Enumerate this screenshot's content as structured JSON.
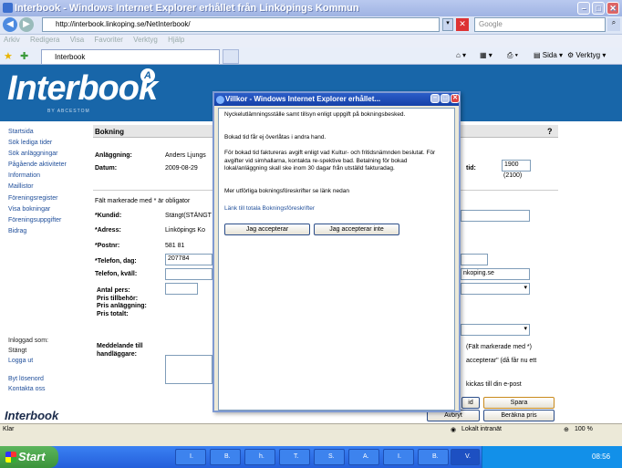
{
  "window": {
    "title": "Interbook - Windows Internet Explorer erhållet från Linköpings Kommun"
  },
  "address": {
    "url": "http://interbook.linkoping.se/NetInterbook/",
    "search_placeholder": "Google"
  },
  "menu": [
    "Arkiv",
    "Redigera",
    "Visa",
    "Favoriter",
    "Verktyg",
    "Hjälp"
  ],
  "tab": {
    "label": "Interbook"
  },
  "toolbar": {
    "sida": "Sida",
    "verktyg": "Verktyg"
  },
  "logo": {
    "text": "Interbook",
    "subtitle": "BY ABCESTOM",
    "badge": "A"
  },
  "sidebar": {
    "items": [
      "Startsida",
      "Sök lediga tider",
      "Sök anläggningar",
      "Pågående aktiviteter",
      "Information",
      "Maillistor",
      "Föreningsregister",
      "Visa bokningar",
      "Föreningsuppgifter",
      "Bidrag"
    ],
    "logged_label": "Inloggad som:",
    "user": "Stängt",
    "logout": "Logga ut",
    "change_pw": "Byt lösenord",
    "contact": "Kontakta oss",
    "footer_logo": "Interbook"
  },
  "booking": {
    "title": "Bokning",
    "help": "?",
    "facility_label": "Anläggning:",
    "facility_value": "Anders Ljungs",
    "date_label": "Datum:",
    "date_value": "2009-08-29",
    "time_label": "tid:",
    "time_value": "1900",
    "time_sub": "(2100)",
    "required_note": "Fält markerade med * är obligator",
    "kund_label": "*Kundid:",
    "kund_value": "Stängt(STÄNGT",
    "adress_label": "*Adress:",
    "adress_value": "Linköpings Ko",
    "postnr_label": "*Postnr:",
    "postnr_value": "581 81",
    "tel_dag_label": "*Telefon, dag:",
    "tel_dag_value": "207784",
    "tel_kvall_label": "Telefon, kväll:",
    "antal_label": "Antal pers:",
    "pris_tillbehor": "Pris tillbehör:",
    "pris_anl": "Pris anläggning:",
    "pris_tot": "Pris totalt:",
    "meddelande_label": "Meddelande till handläggare:",
    "email_value": "nkoping.se",
    "right_note1": "(Fält markerade med *)",
    "right_note2": "accepterar\" (då får nu ett",
    "right_note3": "kickas till din e-post",
    "btn_left": "id",
    "btn_save": "Spara",
    "btn_avbryt": "Avbryt",
    "btn_berakna": "Beräkna pris"
  },
  "dialog": {
    "title": "Villkor - Windows Internet Explorer erhållet...",
    "p1": "Nyckelutlämningsställe samt tillsyn enligt uppgift på bokningsbesked.",
    "p2": "Bokad tid får ej överlåtas i andra hand.",
    "p3": "För bokad tid faktureras avgift enligt vad Kultur- och fritidsnämnden beslutat. För avgifter vid simhallarna, kontakta re-spektive bad. Betalning för bokad lokal/anläggning skall ske inom 30 dagar från utställd fakturadag.",
    "p4": "Mer utförliga bokningsföreskrifter se länk nedan",
    "link": "Länk till totala Bokningsföreskrifter",
    "accept": "Jag accepterar",
    "decline": "Jag accepterar inte"
  },
  "status": {
    "left": "Klar",
    "zone": "Lokalt intranät",
    "zoom": "100 %"
  },
  "taskbar": {
    "start": "Start",
    "buttons": [
      "I.",
      "B.",
      "h.",
      "T.",
      "S.",
      "A.",
      "I.",
      "B.",
      "V."
    ],
    "time": "08:56"
  }
}
